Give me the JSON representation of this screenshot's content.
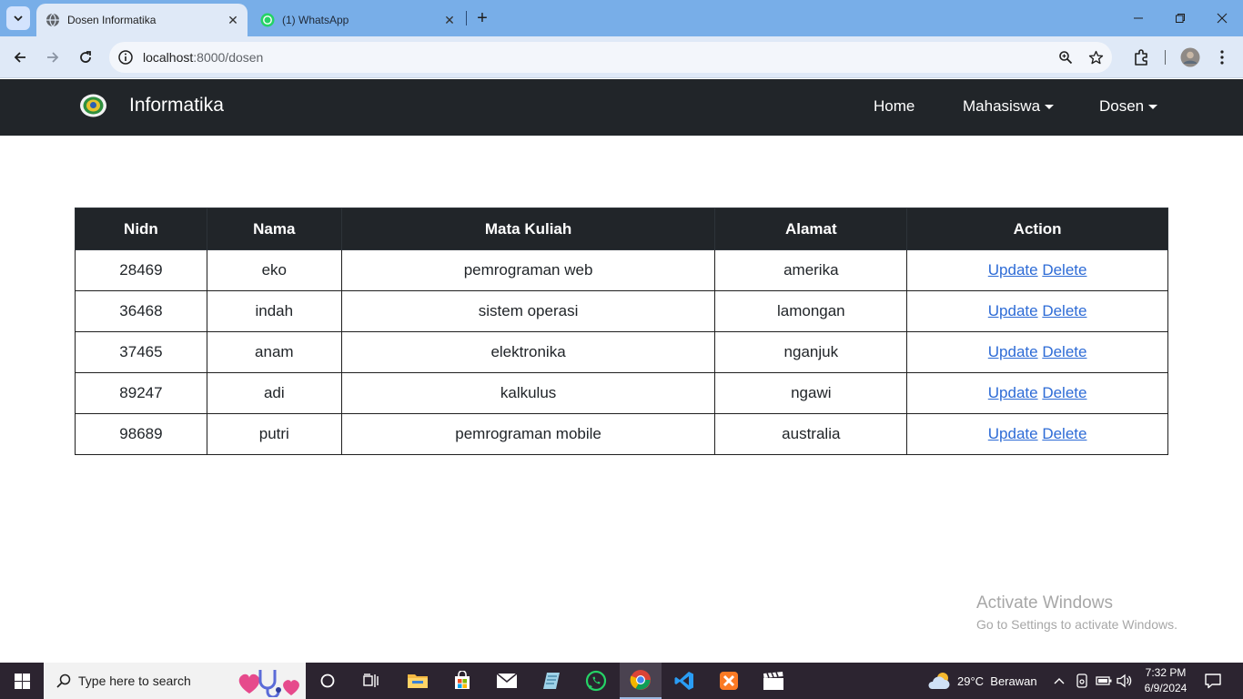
{
  "browser": {
    "tabs": [
      {
        "title": "Dosen Informatika",
        "active": true
      },
      {
        "title": "(1) WhatsApp",
        "active": false
      }
    ],
    "url_host": "localhost",
    "url_path": ":8000/dosen"
  },
  "navbar": {
    "brand": "Informatika",
    "links": [
      {
        "label": "Home"
      },
      {
        "label": "Mahasiswa"
      },
      {
        "label": "Dosen"
      }
    ]
  },
  "table": {
    "headers": [
      "Nidn",
      "Nama",
      "Mata Kuliah",
      "Alamat",
      "Action"
    ],
    "rows": [
      {
        "nidn": "28469",
        "nama": "eko",
        "matkul": "pemrograman web",
        "alamat": "amerika",
        "update": "Update",
        "delete": "Delete"
      },
      {
        "nidn": "36468",
        "nama": "indah",
        "matkul": "sistem operasi",
        "alamat": "lamongan",
        "update": "Update",
        "delete": "Delete"
      },
      {
        "nidn": "37465",
        "nama": "anam",
        "matkul": "elektronika",
        "alamat": "nganjuk",
        "update": "Update",
        "delete": "Delete"
      },
      {
        "nidn": "89247",
        "nama": "adi",
        "matkul": "kalkulus",
        "alamat": "ngawi",
        "update": "Update",
        "delete": "Delete"
      },
      {
        "nidn": "98689",
        "nama": "putri",
        "matkul": "pemrograman mobile",
        "alamat": "australia",
        "update": "Update",
        "delete": "Delete"
      }
    ]
  },
  "watermark": {
    "line1": "Activate Windows",
    "line2": "Go to Settings to activate Windows."
  },
  "taskbar": {
    "search_placeholder": "Type here to search",
    "weather": "29°C  Berawan",
    "time": "7:32 PM",
    "date": "6/9/2024"
  },
  "colors": {
    "tabstrip": "#78aee8",
    "toolbar": "#dfe9f7",
    "navbar": "#212529",
    "link": "#2d6bd6",
    "taskbar": "#2c2430"
  }
}
